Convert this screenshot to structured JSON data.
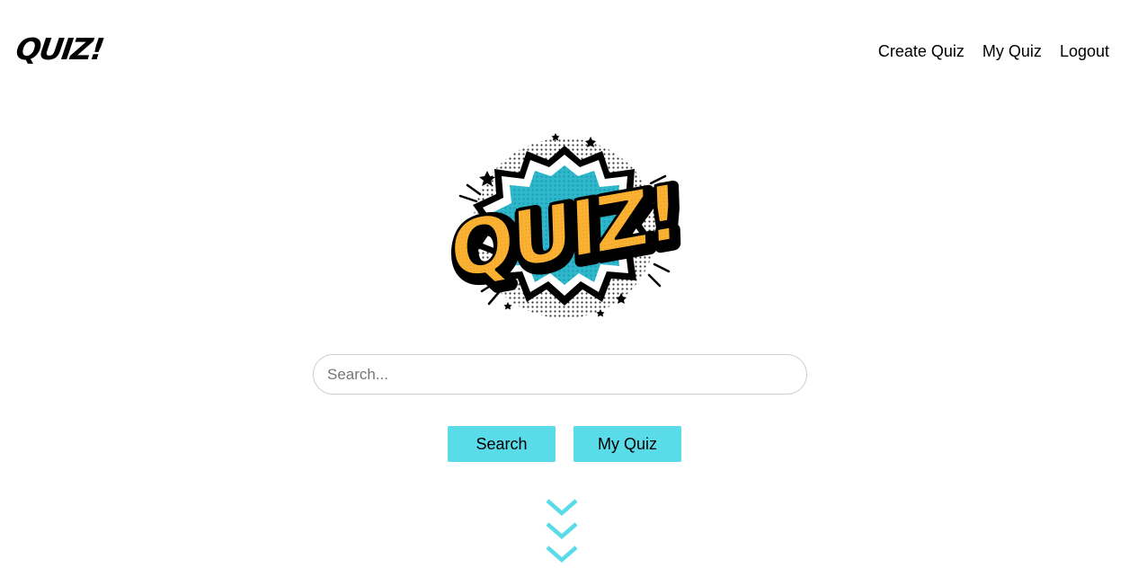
{
  "header": {
    "logo_text": "QUIZ!",
    "nav": [
      {
        "label": "Create Quiz"
      },
      {
        "label": "My Quiz"
      },
      {
        "label": "Logout"
      }
    ]
  },
  "hero": {
    "logo_text": "QUIZ!",
    "colors": {
      "burst": "#29b6c9",
      "letters": "#f9b233",
      "outline": "#000000"
    }
  },
  "search": {
    "placeholder": "Search...",
    "value": ""
  },
  "buttons": {
    "search_label": "Search",
    "my_quiz_label": "My Quiz",
    "color": "#5adbe8"
  },
  "scroll_indicator": {
    "icon": "triple-chevron-down-icon",
    "color": "#5adbe8"
  }
}
